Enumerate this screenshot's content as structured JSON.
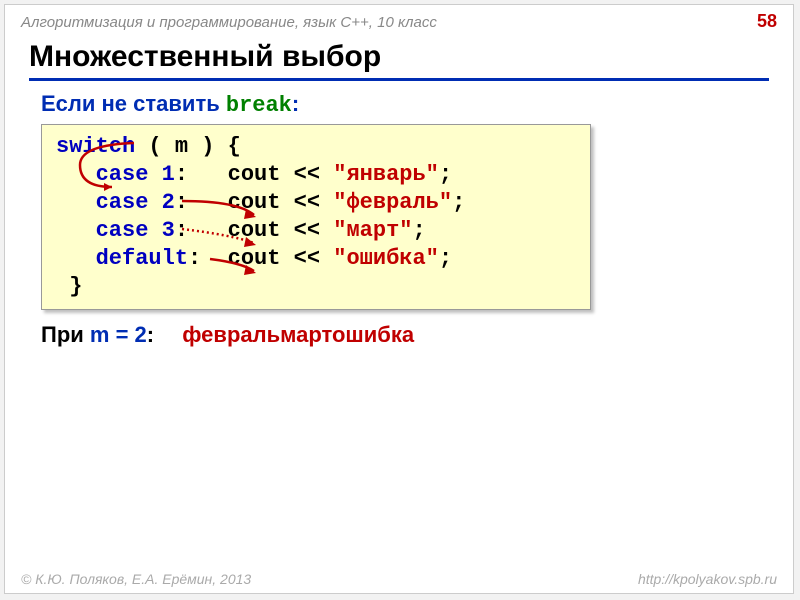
{
  "header": {
    "course": "Алгоритмизация и программирование, язык C++, 10 класс",
    "page": "58"
  },
  "title": "Множественный выбор",
  "subtitle": {
    "prefix": "Если не ставить ",
    "keyword": "break",
    "suffix": ":"
  },
  "code": {
    "l1": {
      "kw": "switch",
      "rest": " ( m ) {"
    },
    "l2": {
      "indent": "   ",
      "kw": "case",
      "num": " 1",
      "colon": ":   ",
      "call": "cout << ",
      "str": "\"январь\"",
      "semi": ";"
    },
    "l3": {
      "indent": "   ",
      "kw": "case",
      "num": " 2",
      "colon": ":   ",
      "call": "cout << ",
      "str": "\"февраль\"",
      "semi": ";"
    },
    "l4": {
      "indent": "   ",
      "kw": "case",
      "num": " 3",
      "colon": ":   ",
      "call": "cout << ",
      "str": "\"март\"",
      "semi": ";"
    },
    "l5": {
      "indent": "   ",
      "kw": "default",
      "colon": ":  ",
      "call": "cout << ",
      "str": "\"ошибка\"",
      "semi": ";"
    },
    "l6": {
      "brace": " }"
    }
  },
  "result": {
    "label_pre": "При ",
    "label_var": "m = 2",
    "label_post": ":",
    "output": "февральмартошибка"
  },
  "footer": {
    "left": "© К.Ю. Поляков, Е.А. Ерёмин, 2013",
    "right": "http://kpolyakov.spb.ru"
  }
}
